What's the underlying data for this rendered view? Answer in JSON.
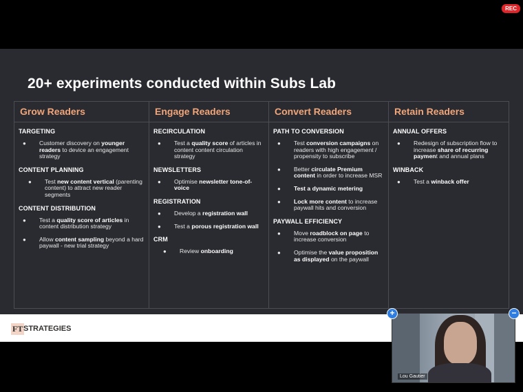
{
  "rec_label": "REC",
  "slide": {
    "title": "20+ experiments conducted within Subs Lab",
    "columns": [
      {
        "heading": "Grow Readers",
        "sections": [
          {
            "label": "TARGETING",
            "items": [
              [
                "Customer discovery on ",
                "younger readers",
                " to device an engagement strategy"
              ]
            ]
          },
          {
            "label": "CONTENT PLANNING",
            "items": [
              [
                "Test ",
                "new content vertical",
                " (parenting content) to attract new reader segments"
              ]
            ]
          },
          {
            "label": "CONTENT DISTRIBUTION",
            "items": [
              [
                "Test a ",
                "quality score of articles",
                " in content distribution strategy"
              ],
              [
                "Allow ",
                "content sampling",
                " beyond a hard paywall - new trial strategy"
              ]
            ]
          }
        ]
      },
      {
        "heading": "Engage Readers",
        "sections": [
          {
            "label": "RECIRCULATION",
            "items": [
              [
                "Test a ",
                "quality score",
                " of articles in content content circulation strategy"
              ]
            ]
          },
          {
            "label": "NEWSLETTERS",
            "items": [
              [
                "Optimise ",
                "newsletter tone-of-voice",
                ""
              ]
            ]
          },
          {
            "label": "REGISTRATION",
            "items": [
              [
                "Develop a ",
                "registration wall",
                ""
              ],
              [
                "Test a ",
                "porous registration wall",
                ""
              ]
            ]
          },
          {
            "label": "CRM",
            "items": [
              [
                "Review ",
                "onboarding",
                ""
              ]
            ]
          }
        ]
      },
      {
        "heading": "Convert Readers",
        "sections": [
          {
            "label": "PATH TO CONVERSION",
            "items": [
              [
                "Test ",
                "conversion campaigns",
                " on readers with high engagement / propensity to subscribe"
              ],
              [
                "Better ",
                "circulate Premium content",
                " in order to increase MSR"
              ],
              [
                "",
                "Test a dynamic metering",
                ""
              ],
              [
                "",
                "Lock more content",
                " to increase paywall hits and conversion"
              ]
            ]
          },
          {
            "label": "PAYWALL EFFICIENCY",
            "items": [
              [
                "Move ",
                "roadblock on page",
                " to increase conversion"
              ],
              [
                "Optimise the ",
                "value proposition as displayed",
                " on the paywall"
              ]
            ]
          }
        ]
      },
      {
        "heading": "Retain Readers",
        "sections": [
          {
            "label": "ANNUAL OFFERS",
            "items": [
              [
                "Redesign of subscription flow to increase ",
                "share of recurring paymen",
                "t and annual plans"
              ]
            ]
          },
          {
            "label": "WINBACK",
            "items": [
              [
                "Test a ",
                "winback offer",
                ""
              ]
            ]
          }
        ]
      }
    ]
  },
  "footer": {
    "logo": "FT",
    "brand": "STRATEGIES"
  },
  "video": {
    "participant_name": "Lou Gautier",
    "add_label": "+",
    "minimize_label": "−"
  },
  "colors": {
    "heading": "#f0a57a",
    "slide_bg": "#2a2b30",
    "accent": "#2f7de1"
  }
}
